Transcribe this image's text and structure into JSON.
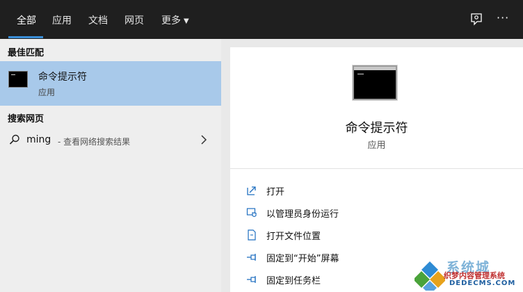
{
  "tabs": [
    {
      "label": "全部",
      "active": true
    },
    {
      "label": "应用",
      "active": false
    },
    {
      "label": "文档",
      "active": false
    },
    {
      "label": "网页",
      "active": false
    },
    {
      "label": "更多",
      "active": false
    }
  ],
  "topbar_icons": [
    "feedback-icon",
    "more-options-icon"
  ],
  "more_options_glyph": "···",
  "best_match": {
    "header": "最佳匹配",
    "title": "命令提示符",
    "subtitle": "应用",
    "icon": "command-prompt-icon"
  },
  "web_search": {
    "header": "搜索网页",
    "query": "ming",
    "suffix": "- 查看网络搜索结果"
  },
  "detail": {
    "title": "命令提示符",
    "subtitle": "应用",
    "actions": [
      {
        "label": "打开",
        "icon": "open-icon"
      },
      {
        "label": "以管理员身份运行",
        "icon": "run-as-admin-icon"
      },
      {
        "label": "打开文件位置",
        "icon": "file-location-icon"
      },
      {
        "label": "固定到“开始”屏幕",
        "icon": "pin-start-icon"
      },
      {
        "label": "固定到任务栏",
        "icon": "pin-taskbar-icon"
      }
    ]
  },
  "watermark": {
    "line1": "系统城",
    "line2": "织梦内容管理系统",
    "line3": "DEDECMS.COM"
  },
  "colors": {
    "topbar_bg": "#1f1f1f",
    "accent": "#3b8fd8",
    "selected_bg": "#a8c9ea",
    "left_bg": "#eeeeee",
    "right_bg": "#ffffff"
  }
}
